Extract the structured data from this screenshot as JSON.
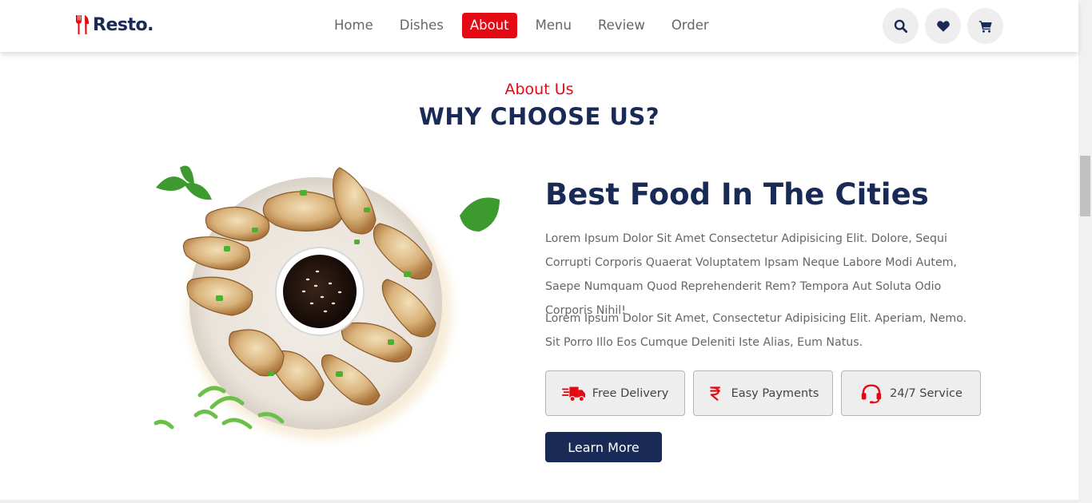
{
  "brand": {
    "name": "Resto."
  },
  "nav": {
    "items": [
      "Home",
      "Dishes",
      "About",
      "Menu",
      "Review",
      "Order"
    ],
    "active": "About"
  },
  "header_icons": [
    "search-icon",
    "heart-icon",
    "cart-icon"
  ],
  "section": {
    "sub_heading": "About Us",
    "heading": "WHY CHOOSE US?"
  },
  "about": {
    "title": "Best Food In The Cities",
    "paragraph1": "Lorem Ipsum Dolor Sit Amet Consectetur Adipisicing Elit. Dolore, Sequi Corrupti Corporis Quaerat Voluptatem Ipsam Neque Labore Modi Autem, Saepe Numquam Quod Reprehenderit Rem? Tempora Aut Soluta Odio Corporis Nihil!",
    "paragraph2": "Lorem Ipsum Dolor Sit Amet, Consectetur Adipisicing Elit. Aperiam, Nemo. Sit Porro Illo Eos Cumque Deleniti Iste Alias, Eum Natus.",
    "features": [
      {
        "label": "Free Delivery",
        "icon": "truck-icon"
      },
      {
        "label": "Easy Payments",
        "icon": "rupee-icon"
      },
      {
        "label": "24/7 Service",
        "icon": "headset-icon"
      }
    ],
    "button_label": "Learn More"
  },
  "colors": {
    "accent": "#e50914",
    "primary": "#192a56",
    "text": "#666666",
    "feature_bg": "#eeeeee"
  }
}
